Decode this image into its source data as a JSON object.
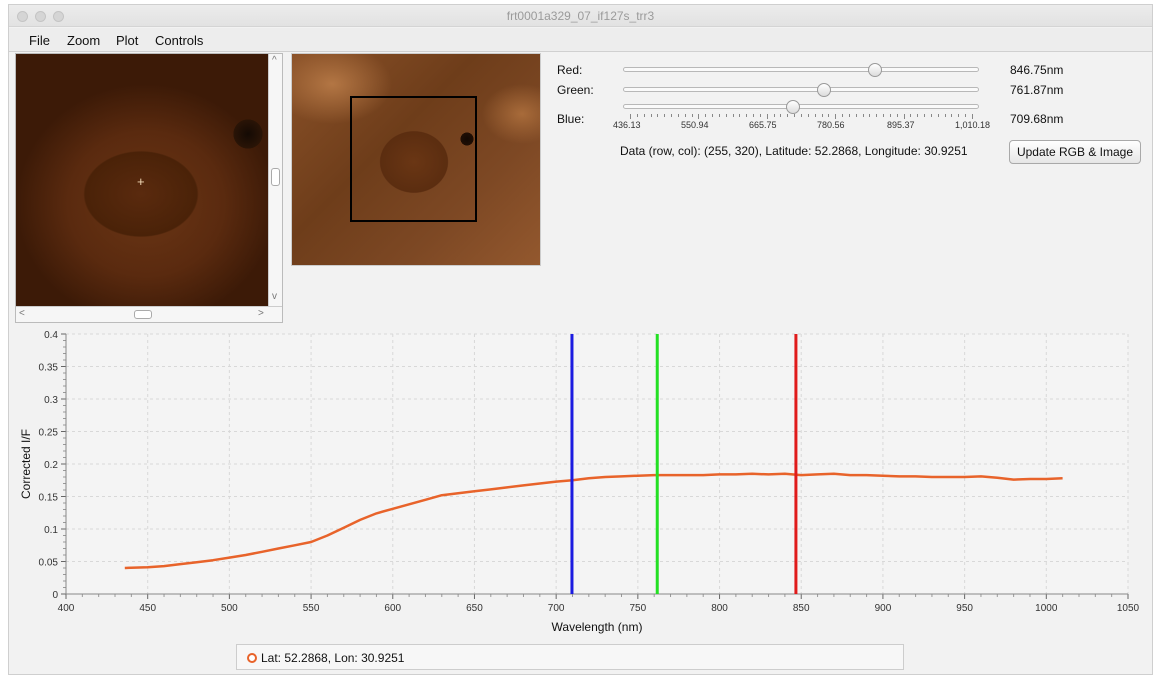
{
  "window": {
    "title": "frt0001a329_07_if127s_trr3"
  },
  "menu": [
    "File",
    "Zoom",
    "Plot",
    "Controls"
  ],
  "controls": {
    "red": {
      "label": "Red:",
      "value": "846.75nm",
      "wavelength": 846.75
    },
    "green": {
      "label": "Green:",
      "value": "761.87nm",
      "wavelength": 761.87
    },
    "blue": {
      "label": "Blue:",
      "value": "709.68nm",
      "wavelength": 709.68
    },
    "slider_range": [
      436.13,
      1010.18
    ],
    "tick_labels": [
      "436.13",
      "550.94",
      "665.75",
      "780.56",
      "895.37",
      "1,010.18"
    ],
    "data_info": "Data (row, col): (255, 320), Latitude: 52.2868, Longitude: 30.9251",
    "update_button": "Update RGB & Image"
  },
  "legend": {
    "label": "Lat: 52.2868, Lon: 30.9251",
    "color": "#e8632a"
  },
  "colors": {
    "series": "#e8632a",
    "red_line": "#e01b1b",
    "green_line": "#23e023",
    "blue_line": "#1b1be0"
  },
  "chart_data": {
    "type": "line",
    "xlabel": "Wavelength (nm)",
    "ylabel": "Corrected I/F",
    "xlim": [
      400,
      1050
    ],
    "ylim": [
      0,
      0.4
    ],
    "xticks": [
      400,
      450,
      500,
      550,
      600,
      650,
      700,
      750,
      800,
      850,
      900,
      950,
      1000,
      1050
    ],
    "xtick_labels": [
      "400",
      "450",
      "500",
      "550",
      "600",
      "650",
      "700",
      "750",
      "800",
      "850",
      "900",
      "950",
      "1000",
      "1050"
    ],
    "yticks": [
      0,
      0.05,
      0.1,
      0.15,
      0.2,
      0.25,
      0.3,
      0.35,
      0.4
    ],
    "ytick_labels": [
      "0",
      "0.05",
      "0.1",
      "0.15",
      "0.2",
      "0.25",
      "0.3",
      "0.35",
      "0.4"
    ],
    "grid": true,
    "legend_position": "bottom",
    "series": [
      {
        "name": "Lat: 52.2868, Lon: 30.9251",
        "x": [
          436,
          450,
          460,
          470,
          480,
          490,
          500,
          510,
          520,
          530,
          540,
          550,
          560,
          570,
          580,
          590,
          600,
          610,
          620,
          630,
          640,
          650,
          660,
          670,
          680,
          690,
          700,
          710,
          720,
          730,
          740,
          750,
          760,
          770,
          780,
          790,
          800,
          810,
          820,
          830,
          840,
          850,
          860,
          870,
          880,
          890,
          900,
          910,
          920,
          930,
          940,
          950,
          960,
          970,
          980,
          990,
          1000,
          1010
        ],
        "y": [
          0.04,
          0.041,
          0.043,
          0.046,
          0.049,
          0.052,
          0.056,
          0.06,
          0.065,
          0.07,
          0.075,
          0.08,
          0.09,
          0.102,
          0.114,
          0.124,
          0.131,
          0.138,
          0.145,
          0.152,
          0.155,
          0.158,
          0.161,
          0.164,
          0.167,
          0.17,
          0.173,
          0.175,
          0.178,
          0.18,
          0.181,
          0.182,
          0.183,
          0.183,
          0.183,
          0.183,
          0.184,
          0.184,
          0.185,
          0.184,
          0.185,
          0.183,
          0.184,
          0.185,
          0.183,
          0.183,
          0.182,
          0.181,
          0.181,
          0.18,
          0.18,
          0.18,
          0.181,
          0.179,
          0.176,
          0.177,
          0.177,
          0.178
        ]
      }
    ],
    "vlines": [
      {
        "x": 709.68,
        "color": "#1b1be0"
      },
      {
        "x": 761.87,
        "color": "#23e023"
      },
      {
        "x": 846.75,
        "color": "#e01b1b"
      }
    ]
  }
}
